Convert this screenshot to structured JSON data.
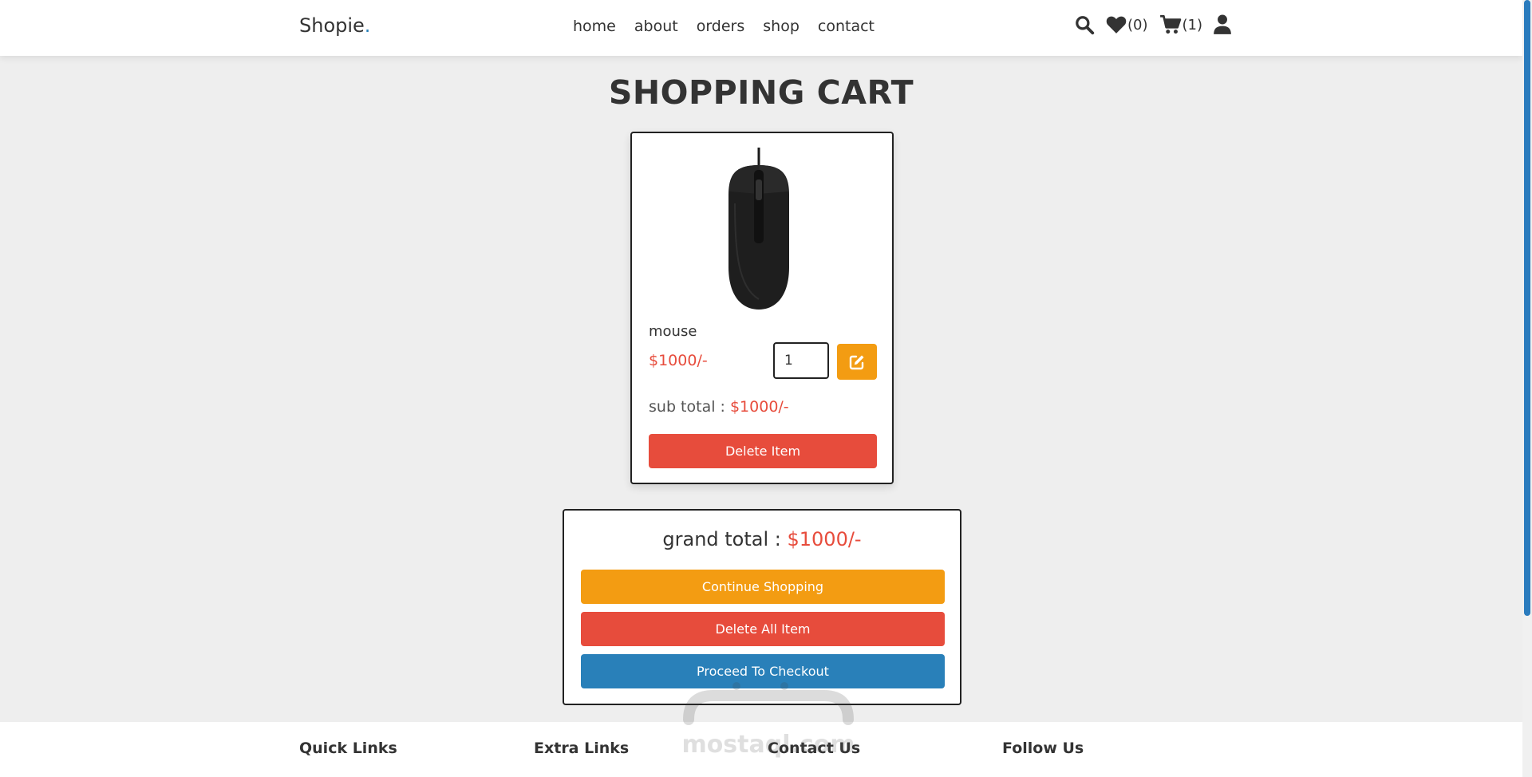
{
  "header": {
    "logo": "Shopie",
    "logo_dot": ".",
    "nav": [
      "home",
      "about",
      "orders",
      "shop",
      "contact"
    ],
    "wishlist_count": "(0)",
    "cart_count": "(1)"
  },
  "page": {
    "title": "SHOPPING CART"
  },
  "cart_item": {
    "name": "mouse",
    "price": "$1000/-",
    "quantity": "1",
    "subtotal_label": "sub total : ",
    "subtotal_value": "$1000/-",
    "delete_label": "Delete Item"
  },
  "totals": {
    "grand_label": "grand total : ",
    "grand_value": "$1000/-",
    "continue_label": "Continue Shopping",
    "delete_all_label": "Delete All Item",
    "checkout_label": "Proceed To Checkout"
  },
  "footer": {
    "sections": [
      "Quick Links",
      "Extra Links",
      "Contact Us",
      "Follow Us"
    ]
  },
  "watermark": {
    "text": "mostaql.com"
  },
  "colors": {
    "accent_orange": "#f39c12",
    "accent_red": "#e74c3c",
    "accent_blue": "#2980b9",
    "background": "#eeeeee"
  },
  "icons": [
    "search-icon",
    "heart-icon",
    "cart-icon",
    "user-icon",
    "edit-icon"
  ]
}
